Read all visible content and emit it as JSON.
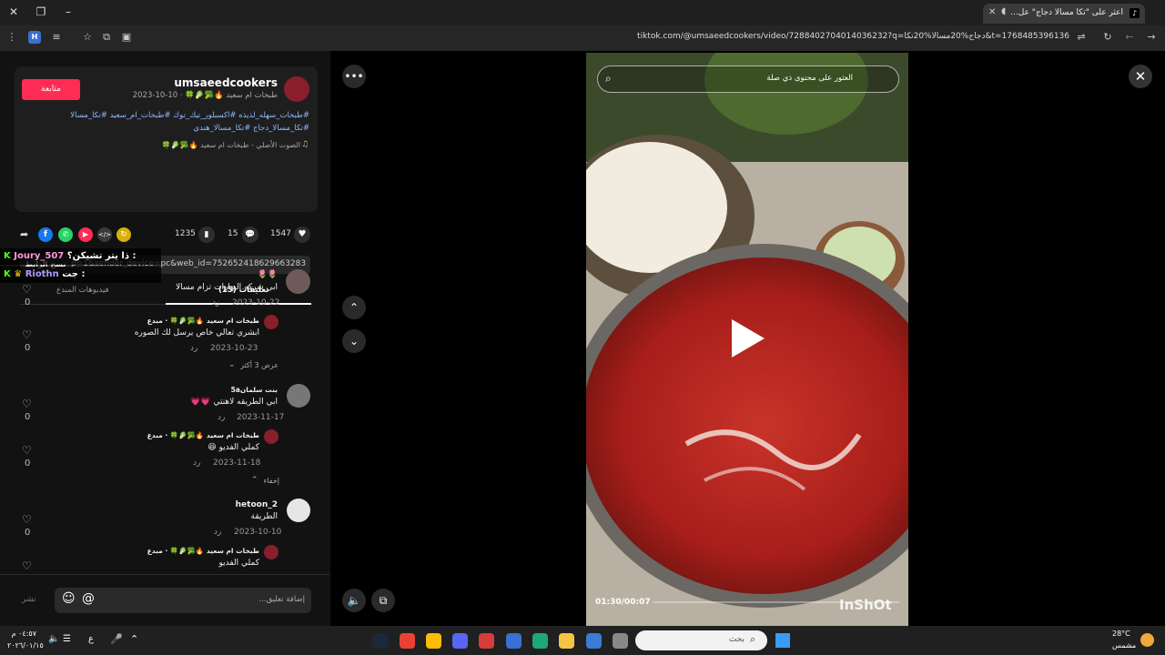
{
  "browser": {
    "tab_title": "اعثر على \"تكا مسالا دجاج\" عل...",
    "url": "tiktok.com/@umsaeedcookers/video/7288402704014036232?q=دجاج%20مسالا%20تكا&t=1768485396136"
  },
  "post": {
    "follow_label": "متابعة",
    "username": "umsaeedcookers",
    "nickname_date": "طبخات ام سعيد 🔥🥦🥬🍀 · 10-10-2023",
    "description_line1": "#طبخات_سهله_لذيذه #اكسبلور_تيك_توك #طبخات_ام_سعيد #تكا_مسالا",
    "description_line2": "#تكا_مسالا_دجاج #تكا_مسالا_هندي",
    "music": "الصوت الأصلي - طبخات ام سعيد 🔥🥦🥬🍀",
    "likes": "1547",
    "comments": "15",
    "saves": "1235",
    "link_text": "p=1&sender_device=pc&web_id=7526524186296632833...",
    "copy_link_label": "نسخ الرابط"
  },
  "tabs": {
    "comments": "(15) تعليقات",
    "creator_videos": "فيديوهات المبدع"
  },
  "overlay": {
    "line1_name": "Joury_507",
    "line1_text": "ذا يتر تشيكن؟ : ",
    "line2_name": "Riothn",
    "line2_text": "جت : "
  },
  "comments": [
    {
      "name": "🌷🌷",
      "text": "ابي شركه اليهارات تزام مسالا",
      "date": "2023-10-22",
      "reply": "رد",
      "likes": "0"
    },
    {
      "name": "طبخات ام سعيد 🔥🥦🥬🍀 · مبدع",
      "text": "ابشري تعالي خاص يرسل لك الصوره",
      "date": "2023-10-23",
      "reply": "رد",
      "likes": "0"
    },
    {
      "view_more": "عرض 3 أكثر"
    },
    {
      "name": "بنت سلمان5a",
      "text": "ابي الطريقه لاهنتي 💗💗",
      "date": "2023-11-17",
      "reply": "رد",
      "likes": "0"
    },
    {
      "name": "طبخات ام سعيد 🔥🥦🥬🍀 · مبدع",
      "text": "كملي الفديو 😆",
      "date": "2023-11-18",
      "reply": "رد",
      "likes": "0"
    },
    {
      "hide": "إخفاء"
    },
    {
      "name": "hetoon_2",
      "text": "الطريقة",
      "date": "2023-10-10",
      "reply": "رد",
      "likes": "0"
    },
    {
      "name": "طبخات ام سعيد 🔥🥦🥬🍀 · مبدع",
      "text": "كملي الفديو"
    }
  ],
  "input": {
    "placeholder": "إضافة تعليق...",
    "post_label": "نشر"
  },
  "video": {
    "search_placeholder": "العثور على محتوى ذي صلة",
    "time": "01:30/00:07",
    "watermark": "InShOt"
  },
  "taskbar": {
    "search_placeholder": "بحث",
    "time": "٠٤:٥٧ م",
    "date": "٢٠٢٦/٠١/١٥",
    "weather_temp": "28°C",
    "weather_desc": "مشمس",
    "lang": "ع"
  }
}
